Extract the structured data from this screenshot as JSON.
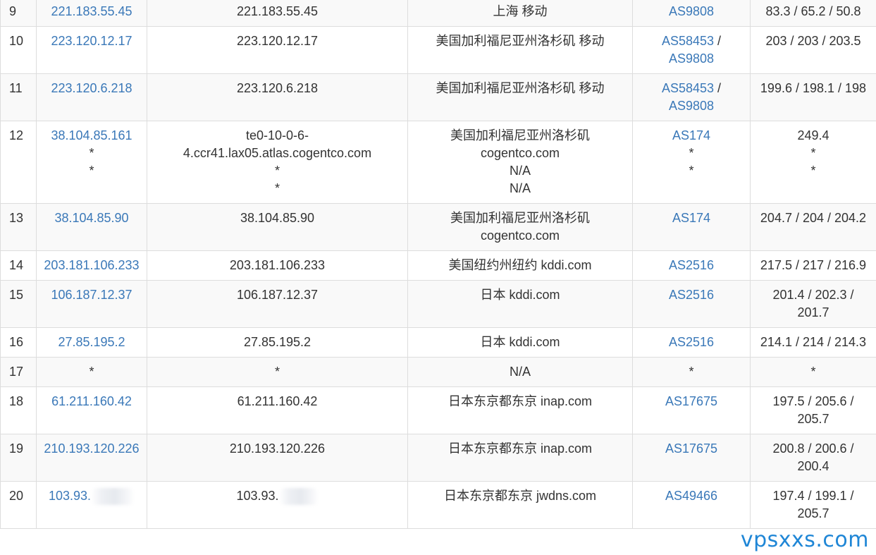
{
  "rows": [
    {
      "hop": "9",
      "ip": [
        "221.183.55.45"
      ],
      "host": [
        "221.183.55.45"
      ],
      "location": [
        "上海 移动"
      ],
      "asn": [
        "AS9808"
      ],
      "asn_sep": "",
      "rtt": [
        "83.3 / 65.2 / 50.8"
      ]
    },
    {
      "hop": "10",
      "ip": [
        "223.120.12.17"
      ],
      "host": [
        "223.120.12.17"
      ],
      "location": [
        "美国加利福尼亚州洛杉矶 移动"
      ],
      "asn": [
        "AS58453",
        "AS9808"
      ],
      "asn_sep": " /",
      "rtt": [
        "203 / 203 / 203.5"
      ]
    },
    {
      "hop": "11",
      "ip": [
        "223.120.6.218"
      ],
      "host": [
        "223.120.6.218"
      ],
      "location": [
        "美国加利福尼亚州洛杉矶 移动"
      ],
      "asn": [
        "AS58453",
        "AS9808"
      ],
      "asn_sep": " /",
      "rtt": [
        "199.6 / 198.1 / 198"
      ]
    },
    {
      "hop": "12",
      "ip": [
        "38.104.85.161",
        "*",
        "*"
      ],
      "host": [
        "te0-10-0-6-",
        "4.ccr41.lax05.atlas.cogentco.com",
        "*",
        "*"
      ],
      "location": [
        "美国加利福尼亚州洛杉矶",
        "cogentco.com",
        "N/A",
        "N/A"
      ],
      "asn": [
        "AS174",
        "*",
        "*"
      ],
      "asn_sep": "",
      "rtt": [
        "249.4",
        "*",
        "*"
      ]
    },
    {
      "hop": "13",
      "ip": [
        "38.104.85.90"
      ],
      "host": [
        "38.104.85.90"
      ],
      "location": [
        "美国加利福尼亚州洛杉矶",
        "cogentco.com"
      ],
      "asn": [
        "AS174"
      ],
      "asn_sep": "",
      "rtt": [
        "204.7 / 204 / 204.2"
      ]
    },
    {
      "hop": "14",
      "ip": [
        "203.181.106.233"
      ],
      "host": [
        "203.181.106.233"
      ],
      "location": [
        "美国纽约州纽约 kddi.com"
      ],
      "asn": [
        "AS2516"
      ],
      "asn_sep": "",
      "rtt": [
        "217.5 / 217 / 216.9"
      ]
    },
    {
      "hop": "15",
      "ip": [
        "106.187.12.37"
      ],
      "host": [
        "106.187.12.37"
      ],
      "location": [
        "日本 kddi.com"
      ],
      "asn": [
        "AS2516"
      ],
      "asn_sep": "",
      "rtt": [
        "201.4 / 202.3 /",
        "201.7"
      ]
    },
    {
      "hop": "16",
      "ip": [
        "27.85.195.2"
      ],
      "host": [
        "27.85.195.2"
      ],
      "location": [
        "日本 kddi.com"
      ],
      "asn": [
        "AS2516"
      ],
      "asn_sep": "",
      "rtt": [
        "214.1 / 214 / 214.3"
      ]
    },
    {
      "hop": "17",
      "ip": [
        "*"
      ],
      "host": [
        "*"
      ],
      "location": [
        "N/A"
      ],
      "asn": [
        "*"
      ],
      "asn_sep": "",
      "rtt": [
        "*"
      ]
    },
    {
      "hop": "18",
      "ip": [
        "61.211.160.42"
      ],
      "host": [
        "61.211.160.42"
      ],
      "location": [
        "日本东京都东京 inap.com"
      ],
      "asn": [
        "AS17675"
      ],
      "asn_sep": "",
      "rtt": [
        "197.5 / 205.6 /",
        "205.7"
      ]
    },
    {
      "hop": "19",
      "ip": [
        "210.193.120.226"
      ],
      "host": [
        "210.193.120.226"
      ],
      "location": [
        "日本东京都东京 inap.com"
      ],
      "asn": [
        "AS17675"
      ],
      "asn_sep": "",
      "rtt": [
        "200.8 / 200.6 /",
        "200.4"
      ]
    },
    {
      "hop": "20",
      "ip": [
        "103.93."
      ],
      "host": [
        "103.93."
      ],
      "location": [
        "日本东京都东京 jwdns.com"
      ],
      "asn": [
        "AS49466"
      ],
      "asn_sep": "",
      "rtt": [
        "197.4 / 199.1 /",
        "205.7"
      ],
      "redacted": true
    }
  ],
  "watermark": "vpsxxs.com",
  "colors": {
    "link": "#3a78b8",
    "text": "#333333",
    "border": "#dddddd",
    "stripe": "#f9f9f9",
    "watermark": "#1f86d6"
  }
}
